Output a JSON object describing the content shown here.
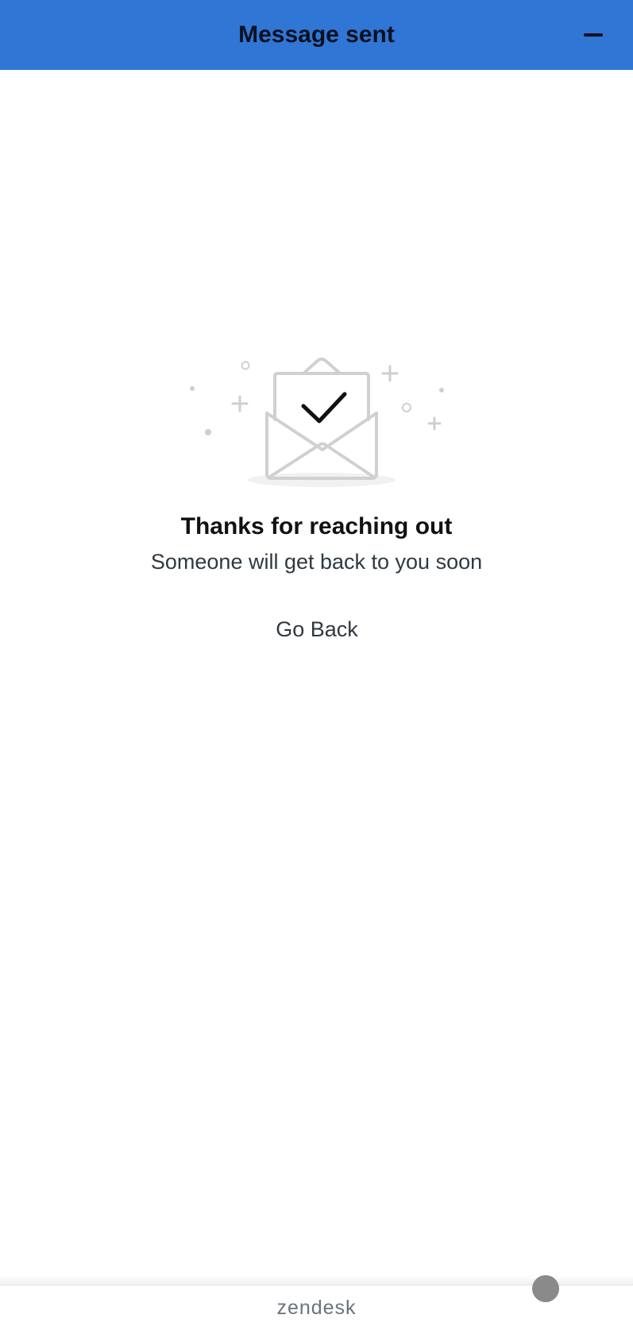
{
  "header": {
    "title": "Message sent"
  },
  "confirmation": {
    "title": "Thanks for reaching out",
    "subtitle": "Someone will get back to you soon",
    "back_label": "Go Back"
  },
  "footer": {
    "brand": "zendesk"
  },
  "colors": {
    "header_bg": "#2f76d5",
    "illustration": "#d0d0d0",
    "check": "#111111"
  },
  "icons": [
    "minimize-icon",
    "envelope-check-illustration"
  ]
}
